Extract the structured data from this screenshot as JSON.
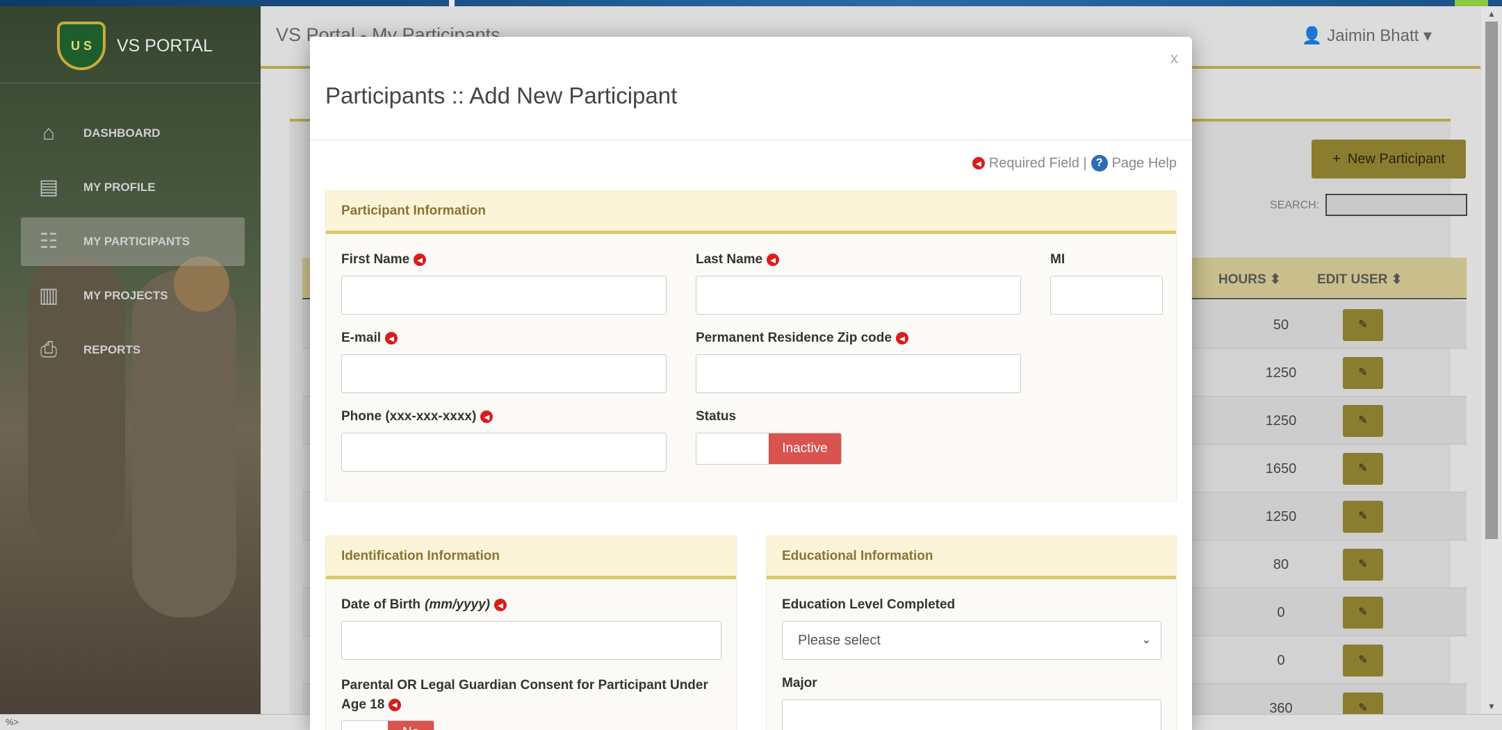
{
  "app": {
    "brand": "VS PORTAL",
    "logo_text": "U S",
    "header_title": "VS Portal - My Participants",
    "user_name": "Jaimin Bhatt",
    "status_text": "%>"
  },
  "sidebar": {
    "items": [
      {
        "label": "DASHBOARD",
        "icon": "home-icon",
        "glyph": "⌂"
      },
      {
        "label": "MY PROFILE",
        "icon": "profile-card-icon",
        "glyph": "▤"
      },
      {
        "label": "MY PARTICIPANTS",
        "icon": "people-icon",
        "glyph": "☷",
        "active": true
      },
      {
        "label": "MY PROJECTS",
        "icon": "documents-icon",
        "glyph": "▥"
      },
      {
        "label": "REPORTS",
        "icon": "printer-icon",
        "glyph": "⎙"
      }
    ]
  },
  "background_page": {
    "new_button": "New Participant",
    "new_button_glyph": "+",
    "search_label": "SEARCH:",
    "columns": {
      "hours": "HOURS",
      "edit_user": "EDIT USER"
    },
    "sort_glyph": "⬍",
    "edit_glyph": "✎",
    "hours": [
      "50",
      "1250",
      "1250",
      "1650",
      "1250",
      "80",
      "0",
      "0",
      "360"
    ]
  },
  "modal": {
    "close": "x",
    "title": "Participants :: Add New Participant",
    "required_legend": "Required Field |",
    "page_help": "Page Help",
    "required_glyph": "◄",
    "help_glyph": "?",
    "participant_info": {
      "heading": "Participant Information",
      "first_name": "First Name",
      "last_name": "Last Name",
      "mi": "MI",
      "email": "E-mail",
      "zip": "Permanent Residence Zip code",
      "phone": "Phone (xxx-xxx-xxxx)",
      "status": "Status",
      "status_value": "Inactive"
    },
    "identification": {
      "heading": "Identification Information",
      "dob": "Date of Birth",
      "dob_format": "(mm/yyyy)",
      "consent_line1": "Parental OR Legal Guardian Consent for Participant Under",
      "consent_line2": "Age 18",
      "consent_value": "No"
    },
    "education": {
      "heading": "Educational Information",
      "level": "Education Level Completed",
      "level_value": "Please select",
      "major": "Major"
    }
  },
  "colors": {
    "accent_gold": "#b5a64a",
    "required_red": "#d91c1c",
    "inactive_red": "#d9534f",
    "help_blue": "#2f6cb5"
  }
}
